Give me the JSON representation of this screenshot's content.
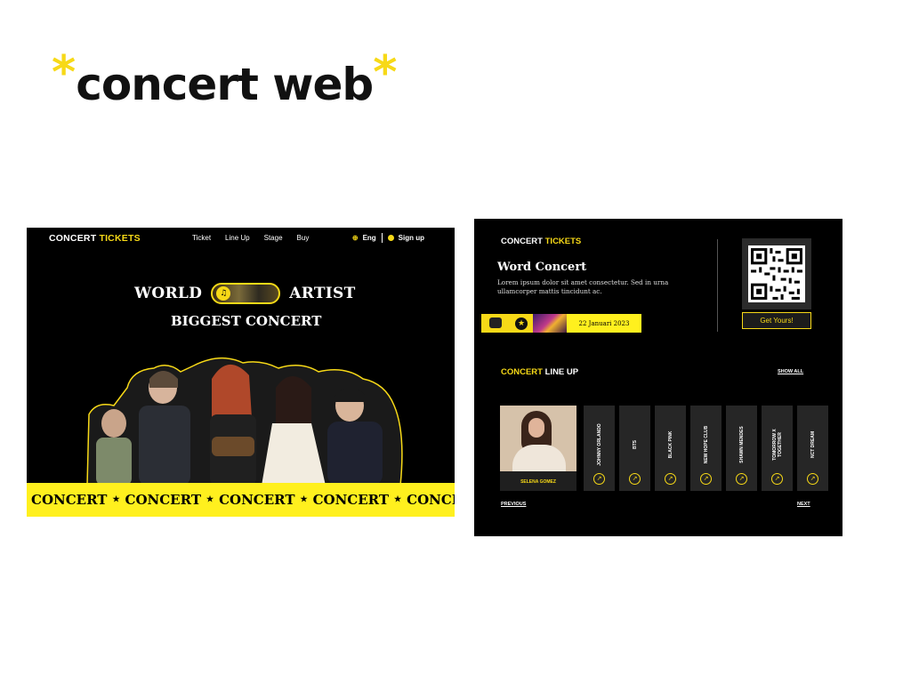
{
  "slide": {
    "title": "concert web",
    "star": "*"
  },
  "left_mockup": {
    "nav": {
      "logo_white": "CONCERT",
      "logo_yellow": "TICKETS",
      "links": [
        "Ticket",
        "Line Up",
        "Stage",
        "Buy"
      ],
      "language": "Eng",
      "signup": "Sign up"
    },
    "hero": {
      "word1": "WORLD",
      "word2": "ARTIST",
      "subtitle": "BIGGEST CONCERT",
      "pill_icon": "♫"
    },
    "band": {
      "items": [
        "CONCERT",
        "CONCERT",
        "CONCERT",
        "CONCERT",
        "CONCERT"
      ],
      "separator": "★"
    }
  },
  "right_mockup": {
    "logo_white": "CONCERT",
    "logo_yellow": "TICKETS",
    "event_title": "Word Concert",
    "event_desc": "Lorem ipsum dolor sit amet consectetur. Sed in urna ullamcorper mattis tincidunt ac.",
    "date": "22 Januari 2023",
    "get_button": "Get Yours!",
    "lineup_yellow": "CONCERT",
    "lineup_white": "LINE UP",
    "show_all": "SHOW ALL",
    "featured_artist": "SELENA GOMEZ",
    "artists": [
      "JOHNNY ORLANDO",
      "BTS",
      "BLACK PINK",
      "NEW HOPE CLUB",
      "SHAWN MENDES",
      "TOMORROW X TOGETHER",
      "NCT DREAM"
    ],
    "previous": "PREVIOUS",
    "next": "NEXT"
  },
  "colors": {
    "accent": "#f7d917",
    "band": "#fff01e",
    "background": "#000000",
    "card": "#262626"
  }
}
